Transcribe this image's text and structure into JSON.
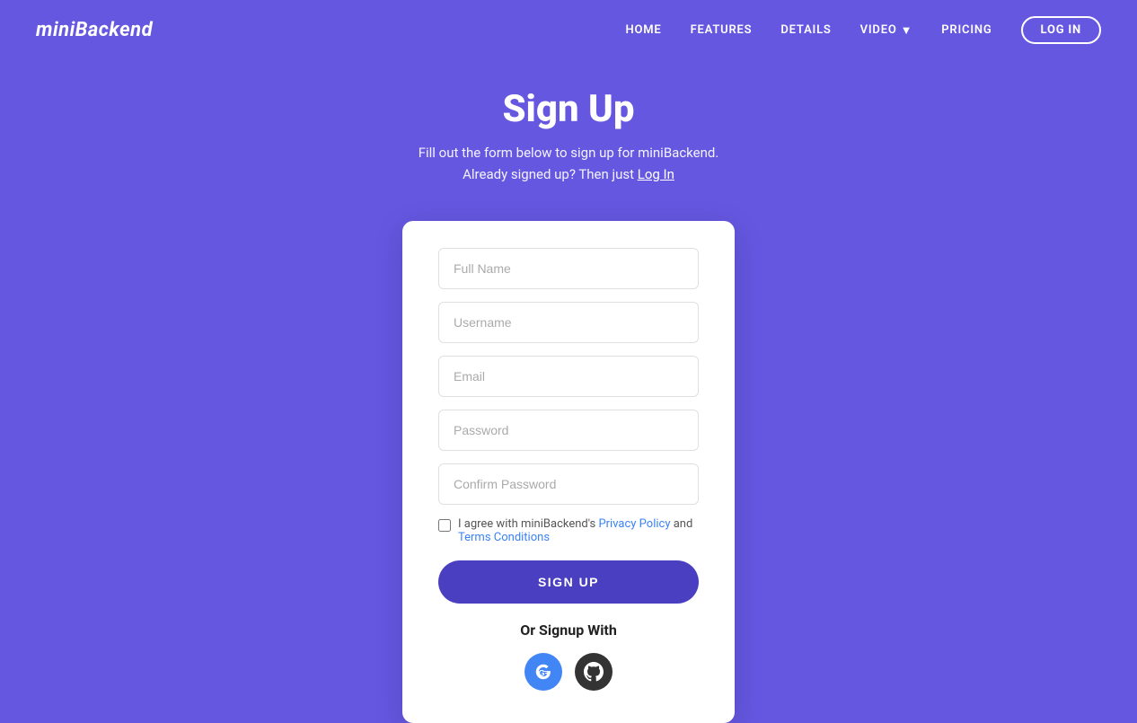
{
  "brand": {
    "logo": "miniBackend"
  },
  "nav": {
    "links": [
      {
        "label": "HOME",
        "href": "#"
      },
      {
        "label": "FEATURES",
        "href": "#"
      },
      {
        "label": "DETAILS",
        "href": "#"
      },
      {
        "label": "VIDEO",
        "href": "#",
        "hasDropdown": true
      },
      {
        "label": "PRICING",
        "href": "#"
      }
    ],
    "login_label": "LOG IN"
  },
  "hero": {
    "title": "Sign Up",
    "subtitle": "Fill out the form below to sign up for miniBackend.",
    "already_signed": "Already signed up? Then just ",
    "login_link": "Log In"
  },
  "form": {
    "fields": [
      {
        "name": "full-name",
        "placeholder": "Full Name",
        "type": "text"
      },
      {
        "name": "username",
        "placeholder": "Username",
        "type": "text"
      },
      {
        "name": "email",
        "placeholder": "Email",
        "type": "email"
      },
      {
        "name": "password",
        "placeholder": "Password",
        "type": "password"
      },
      {
        "name": "confirm-password",
        "placeholder": "Confirm Password",
        "type": "password"
      }
    ],
    "checkbox_text_before": "I agree with miniBackend's ",
    "privacy_link": "Privacy Policy",
    "checkbox_text_middle": " and ",
    "terms_link": "Terms Conditions",
    "signup_button": "SIGN UP",
    "or_text": "Or Signup With",
    "social": [
      {
        "name": "google",
        "label": "G+"
      },
      {
        "name": "github",
        "label": "GitHub"
      }
    ]
  },
  "colors": {
    "background": "#6557e0",
    "button_bg": "#4a3fc0",
    "link_blue": "#3b82f6"
  }
}
